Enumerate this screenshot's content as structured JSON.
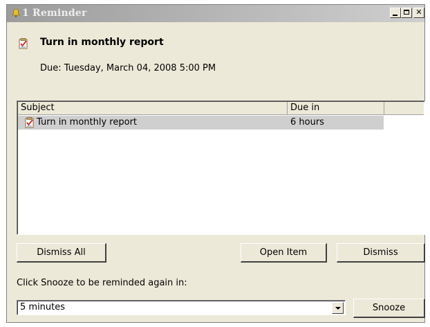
{
  "window": {
    "title": "1 Reminder",
    "title_icon": "bell-icon",
    "titlebar_color": "#b0b0b0"
  },
  "reminder": {
    "icon": "task-icon",
    "subject": "Turn in monthly report",
    "due": "Due: Tuesday, March 04, 2008 5:00 PM"
  },
  "list": {
    "columns": [
      "Subject",
      "Due in"
    ],
    "rows": [
      {
        "icon": "task-icon",
        "subject": "Turn in monthly report",
        "due_in": "6 hours",
        "selected": true
      }
    ],
    "selected_row_color": "#cfcfcf"
  },
  "buttons": {
    "dismiss_all": "Dismiss All",
    "open_item": "Open Item",
    "dismiss": "Dismiss",
    "snooze": "Snooze"
  },
  "snooze": {
    "label": "Click Snooze to be reminded again in:",
    "selected": "5 minutes"
  }
}
